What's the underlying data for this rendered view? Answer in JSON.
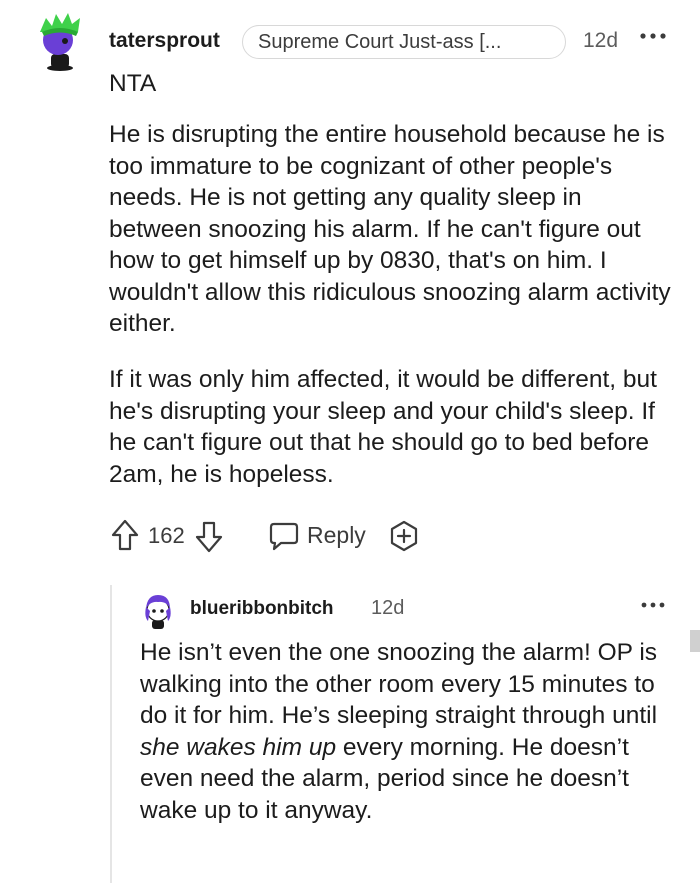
{
  "comment": {
    "username": "tatersprout",
    "flair": "Supreme Court Just-ass [...",
    "timestamp": "12d",
    "paragraphs": [
      "NTA",
      "He is disrupting the entire household because he is too immature to be cognizant of other people's needs. He is not getting any quality sleep in between snoozing his alarm. If he can't figure out how to get himself up by 0830, that's on him. I wouldn't allow this ridiculous snoozing alarm activity either.",
      "If it was only him affected, it would be different, but he's disrupting your sleep and your child's sleep. If he can't figure out that he should go to bed before 2am, he is hopeless."
    ],
    "score": "162",
    "reply_label": "Reply",
    "icons": {
      "more": "more-options-icon",
      "upvote": "upvote-arrow-icon",
      "downvote": "downvote-arrow-icon",
      "reply": "speech-bubble-icon",
      "award": "award-plus-icon"
    }
  },
  "reply": {
    "username": "blueribbonbitch",
    "timestamp": "12d",
    "text_before": "He isn’t even the one snoozing the alarm! OP is walking into the other room every 15 minutes to do it for him. He’s sleeping straight through until ",
    "text_italic": "she wakes him up",
    "text_after": " every morning. He doesn’t even need the alarm, period since he doesn’t wake up to it anyway."
  },
  "colors": {
    "text": "#1c1c1c",
    "meta": "#5c5c5c",
    "border": "#d8d8d8",
    "avatar_green": "#3fd14a",
    "avatar_purple": "#6a3fd6"
  }
}
